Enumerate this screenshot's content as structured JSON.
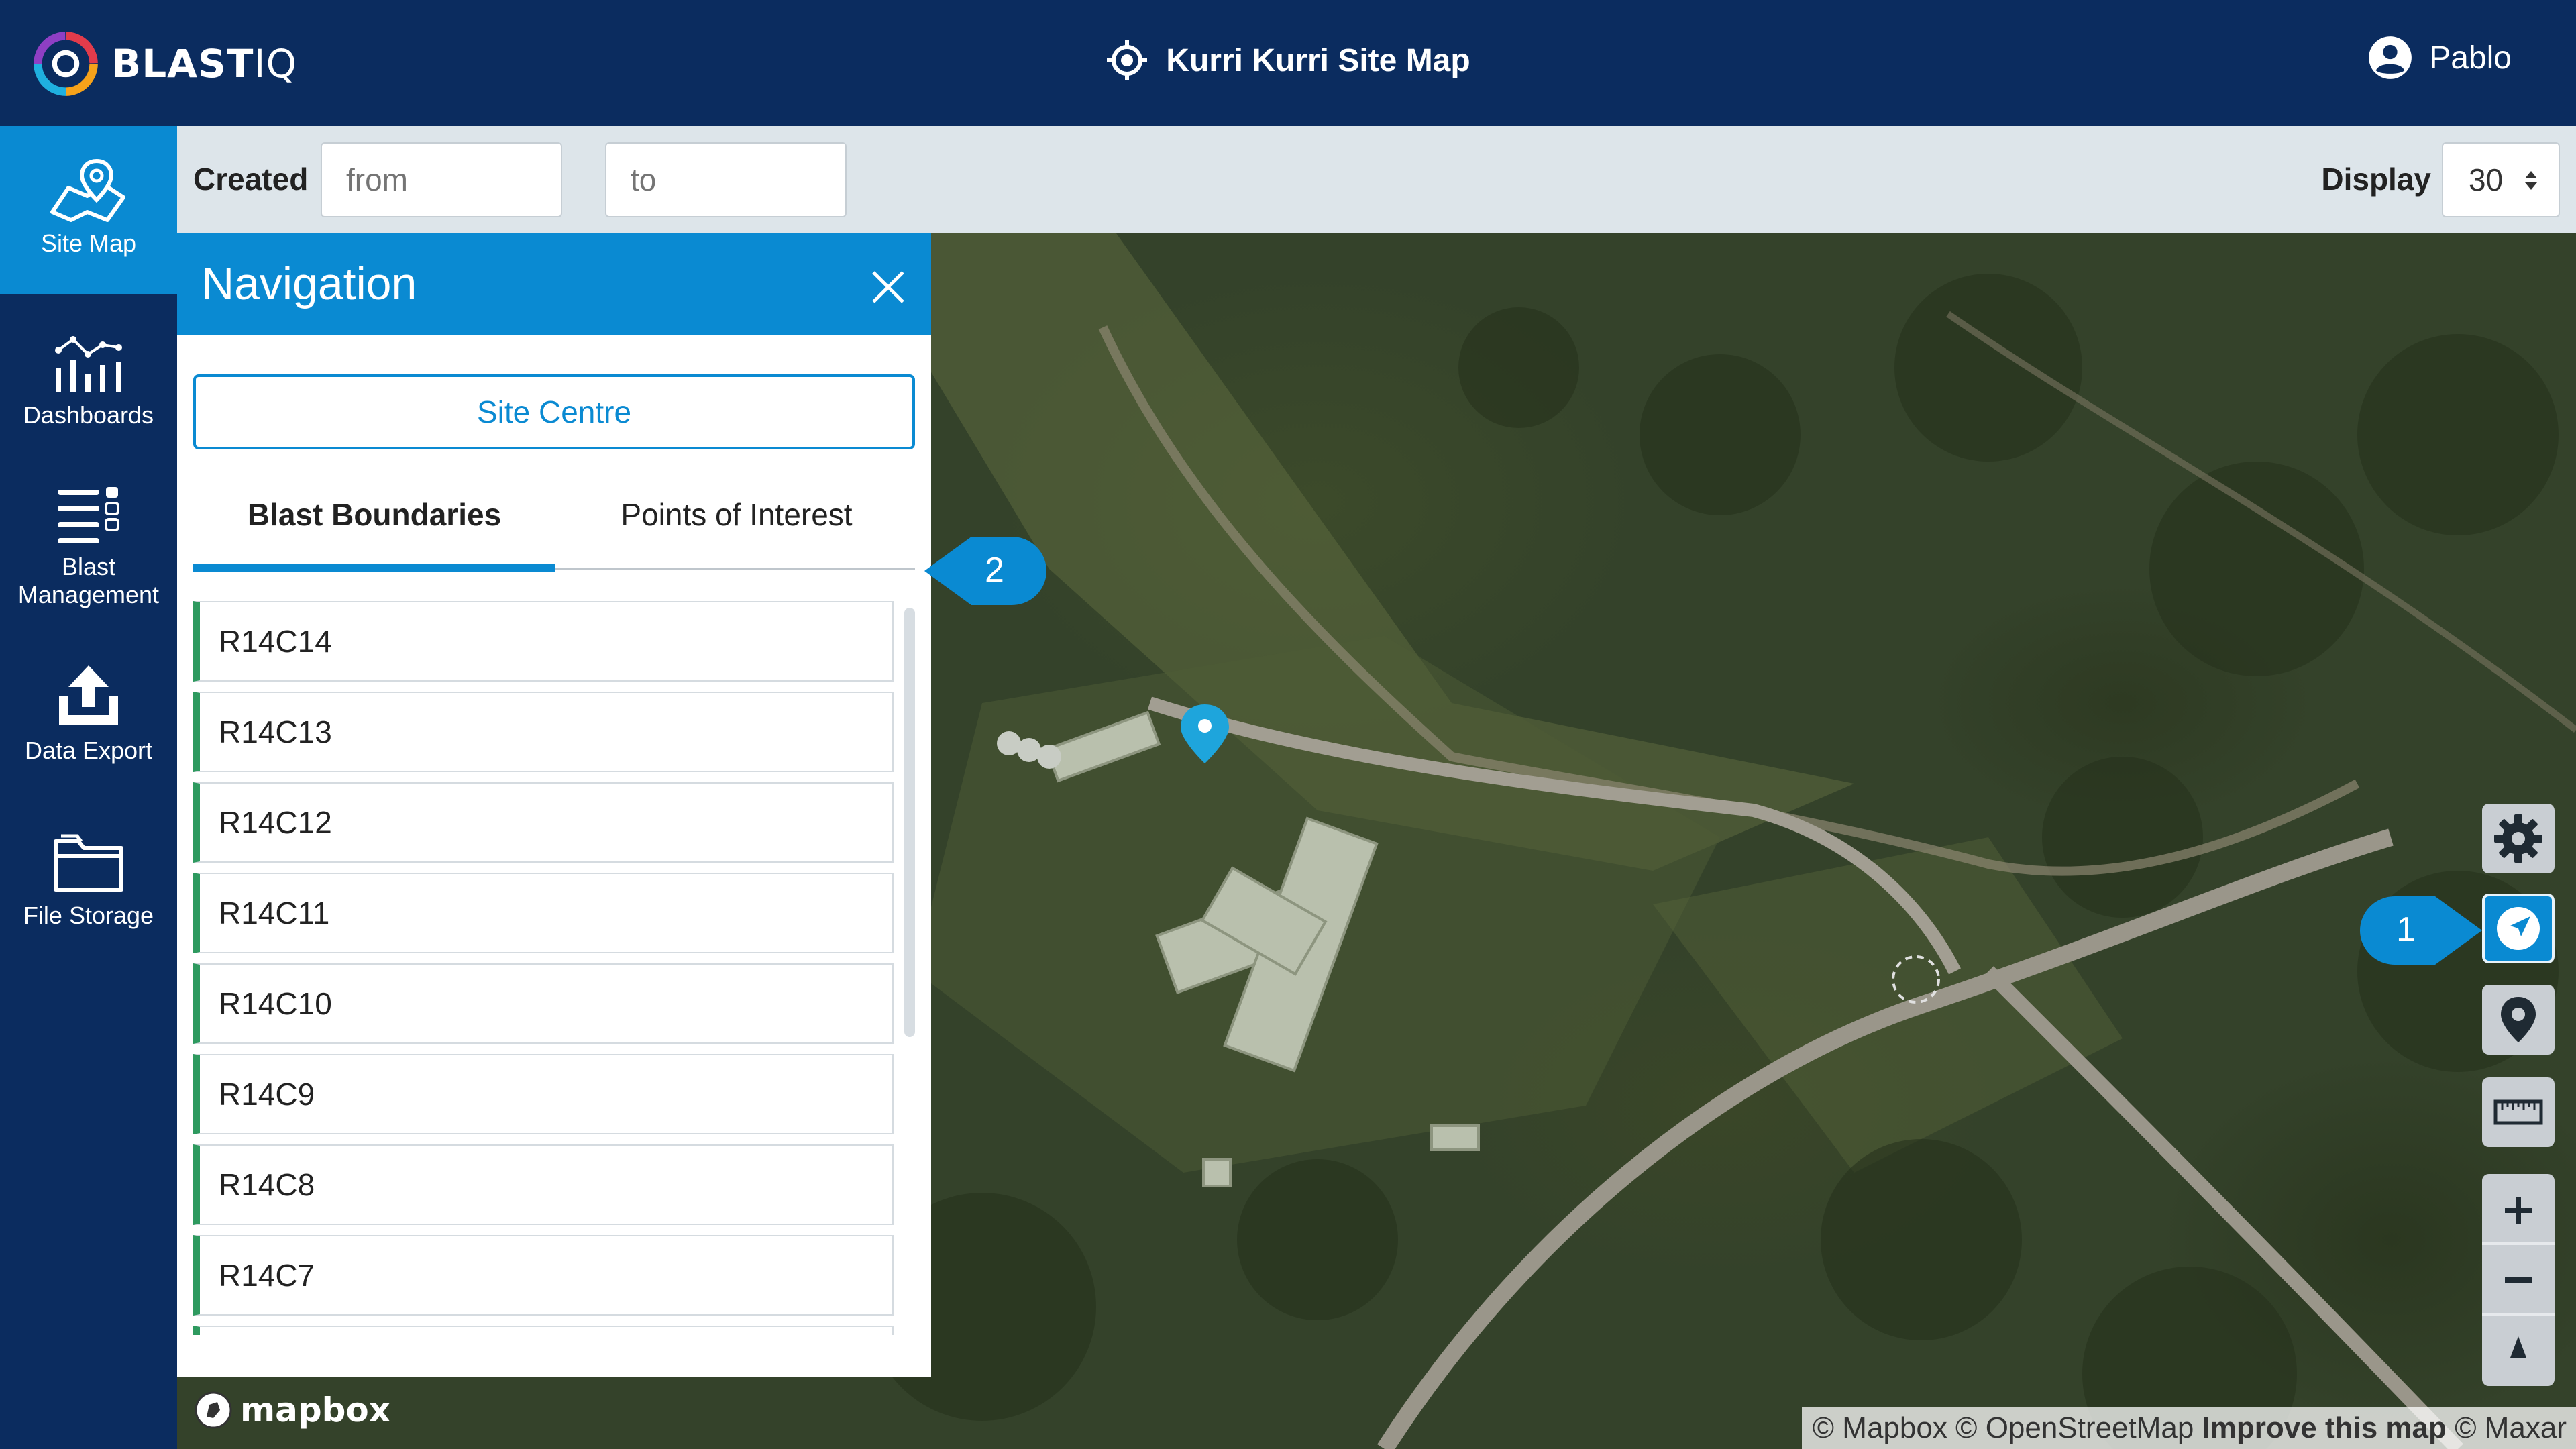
{
  "header": {
    "logo_main": "BLAST",
    "logo_suffix": "IQ",
    "site_title": "Kurri Kurri Site Map",
    "user_name": "Pablo"
  },
  "sidebar": {
    "items": [
      {
        "label": "Site Map",
        "icon": "map-icon",
        "active": true
      },
      {
        "label": "Dashboards",
        "icon": "dashboard-chart-icon"
      },
      {
        "label": "Blast Management",
        "icon": "list-management-icon"
      },
      {
        "label": "Data Export",
        "icon": "upload-icon"
      },
      {
        "label": "File Storage",
        "icon": "folder-icon"
      }
    ]
  },
  "filter": {
    "created_label": "Created",
    "from_placeholder": "from",
    "separator": "-",
    "to_placeholder": "to",
    "display_label": "Display",
    "display_value": "30"
  },
  "navigation": {
    "title": "Navigation",
    "site_centre_label": "Site Centre",
    "tabs": [
      {
        "label": "Blast Boundaries",
        "active": true
      },
      {
        "label": "Points of Interest",
        "active": false
      }
    ],
    "boundaries": [
      "R14C14",
      "R14C13",
      "R14C12",
      "R14C11",
      "R14C10",
      "R14C9",
      "R14C8",
      "R14C7"
    ]
  },
  "callouts": {
    "one": "1",
    "two": "2"
  },
  "map": {
    "logo_text": "mapbox",
    "attribution_1": "© Mapbox © OpenStreetMap",
    "attribution_improve": "Improve this map",
    "attribution_2": "© Maxar"
  },
  "colors": {
    "header_bg": "#0b2c5f",
    "accent": "#0a8ad2",
    "boundary_marker": "#2e9a5f"
  }
}
